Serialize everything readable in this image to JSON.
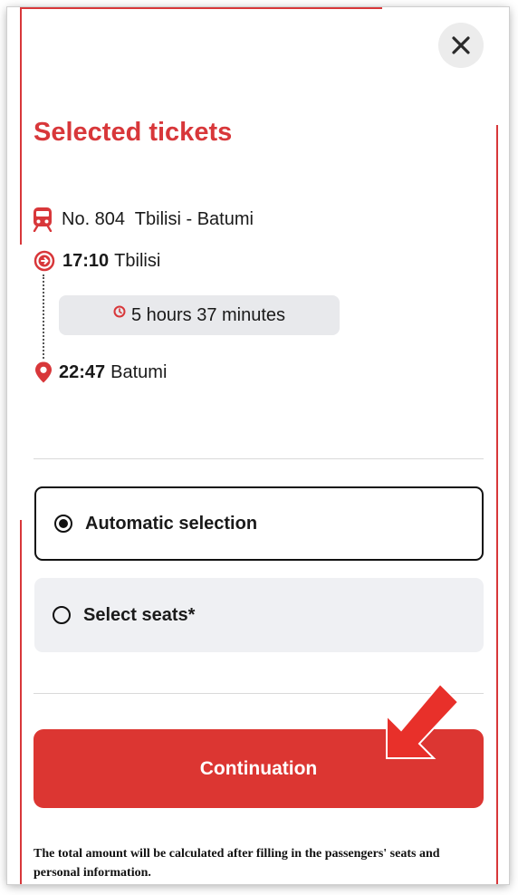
{
  "header": {
    "title": "Selected tickets",
    "close_icon": "close-icon"
  },
  "train": {
    "icon": "train-icon",
    "label": "No. 804  Tbilisi - Batumi"
  },
  "route": {
    "departure": {
      "icon": "departure-arrow-icon",
      "time": "17:10",
      "city": "Tbilisi"
    },
    "duration": {
      "icon": "clock-icon",
      "text": "5 hours 37 minutes"
    },
    "arrival": {
      "icon": "location-pin-icon",
      "time": "22:47",
      "city": "Batumi"
    }
  },
  "seat_options": [
    {
      "label": "Automatic selection",
      "selected": true
    },
    {
      "label": "Select seats*",
      "selected": false
    }
  ],
  "continue_label": "Continuation",
  "footnote": "The total amount will be calculated after filling in the passengers' seats and personal information.",
  "colors": {
    "accent": "#d8373a",
    "button": "#dc3632",
    "annotation_arrow": "#e8302a"
  }
}
